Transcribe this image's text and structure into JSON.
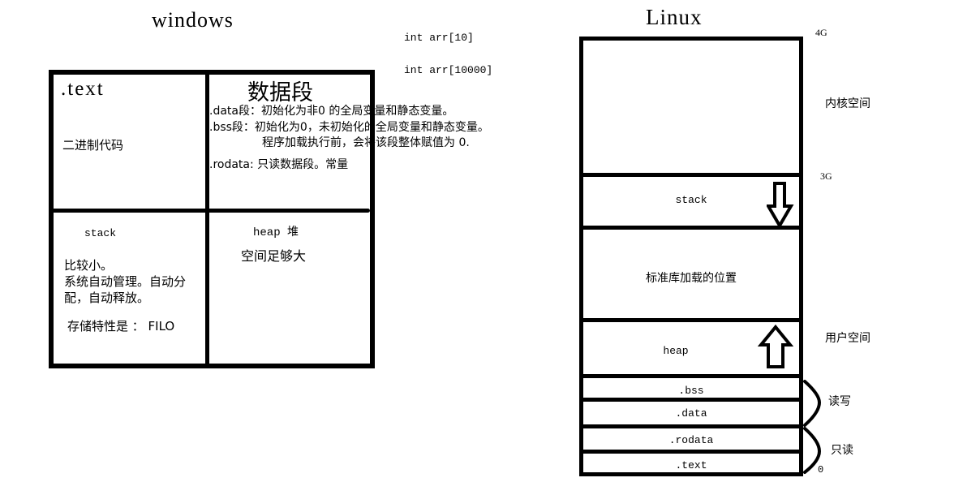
{
  "windows": {
    "title": "windows",
    "code_notes": [
      "int arr[10]",
      "int arr[10000]"
    ],
    "text_section": {
      "heading": ".text",
      "description": "二进制代码"
    },
    "data_section": {
      "heading": "数据段",
      "lines": [
        ".data段：初始化为非0 的全局变量和静态变量。",
        ".bss段：初始化为0，未初始化的全局变量和静态变量。",
        "程序加载执行前，会将该段整体赋值为 0.",
        ".rodata: 只读数据段。常量"
      ]
    },
    "stack_section": {
      "heading": "stack",
      "lines": [
        "比较小。",
        "系统自动管理。自动分",
        "配，自动释放。",
        "存储特性是 ：  FILO"
      ]
    },
    "heap_section": {
      "heading": "heap 堆",
      "description": "空间足够大"
    }
  },
  "linux": {
    "title": "Linux",
    "segments": [
      {
        "label": ""
      },
      {
        "label": "stack"
      },
      {
        "label": "标准库加载的位置"
      },
      {
        "label": "heap"
      },
      {
        "label": ".bss"
      },
      {
        "label": ".data"
      },
      {
        "label": ".rodata"
      },
      {
        "label": ".text"
      }
    ],
    "address_marks": {
      "top": "4G",
      "kernel_boundary": "3G",
      "bottom": "0"
    },
    "region_labels": {
      "kernel": "内核空间",
      "user": "用户空间"
    },
    "brace_labels": {
      "read_write": "读写",
      "read_only": "只读"
    },
    "arrows": {
      "stack": "down-arrow",
      "heap": "up-arrow"
    }
  }
}
